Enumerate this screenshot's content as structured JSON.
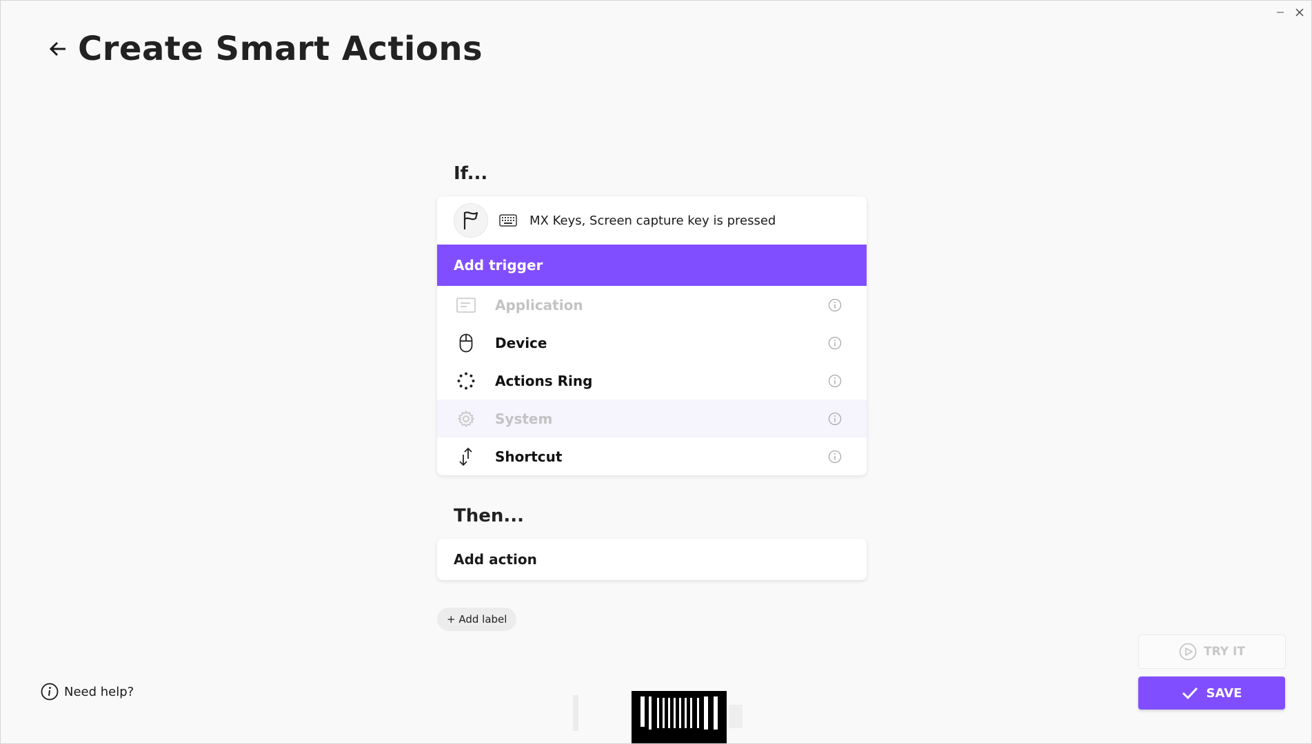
{
  "window": {
    "minimize_icon": "minimize-icon",
    "close_icon": "close-icon"
  },
  "header": {
    "title": "Create Smart Actions",
    "back_icon": "arrow-left-icon"
  },
  "if_section": {
    "label": "If...",
    "trigger": {
      "text": "MX Keys, Screen capture key is pressed",
      "icon": "flag-icon",
      "device_icon": "keyboard-icon"
    },
    "add_trigger_label": "Add trigger",
    "menu_items": [
      {
        "label": "Application",
        "icon": "application-icon",
        "disabled": true
      },
      {
        "label": "Device",
        "icon": "mouse-icon",
        "disabled": false
      },
      {
        "label": "Actions Ring",
        "icon": "actions-ring-icon",
        "disabled": false
      },
      {
        "label": "System",
        "icon": "gear-icon",
        "disabled": true
      },
      {
        "label": "Shortcut",
        "icon": "shortcut-arrows-icon",
        "disabled": false
      }
    ]
  },
  "then_section": {
    "label": "Then...",
    "add_action_label": "Add action"
  },
  "add_label_button": "+ Add label",
  "help": {
    "label": "Need help?"
  },
  "try_button": {
    "label": "TRY IT"
  },
  "save_button": {
    "label": "SAVE"
  },
  "colors": {
    "accent": "#814eff",
    "background": "#f9f9f9",
    "disabled_text": "#c3c3c3"
  }
}
